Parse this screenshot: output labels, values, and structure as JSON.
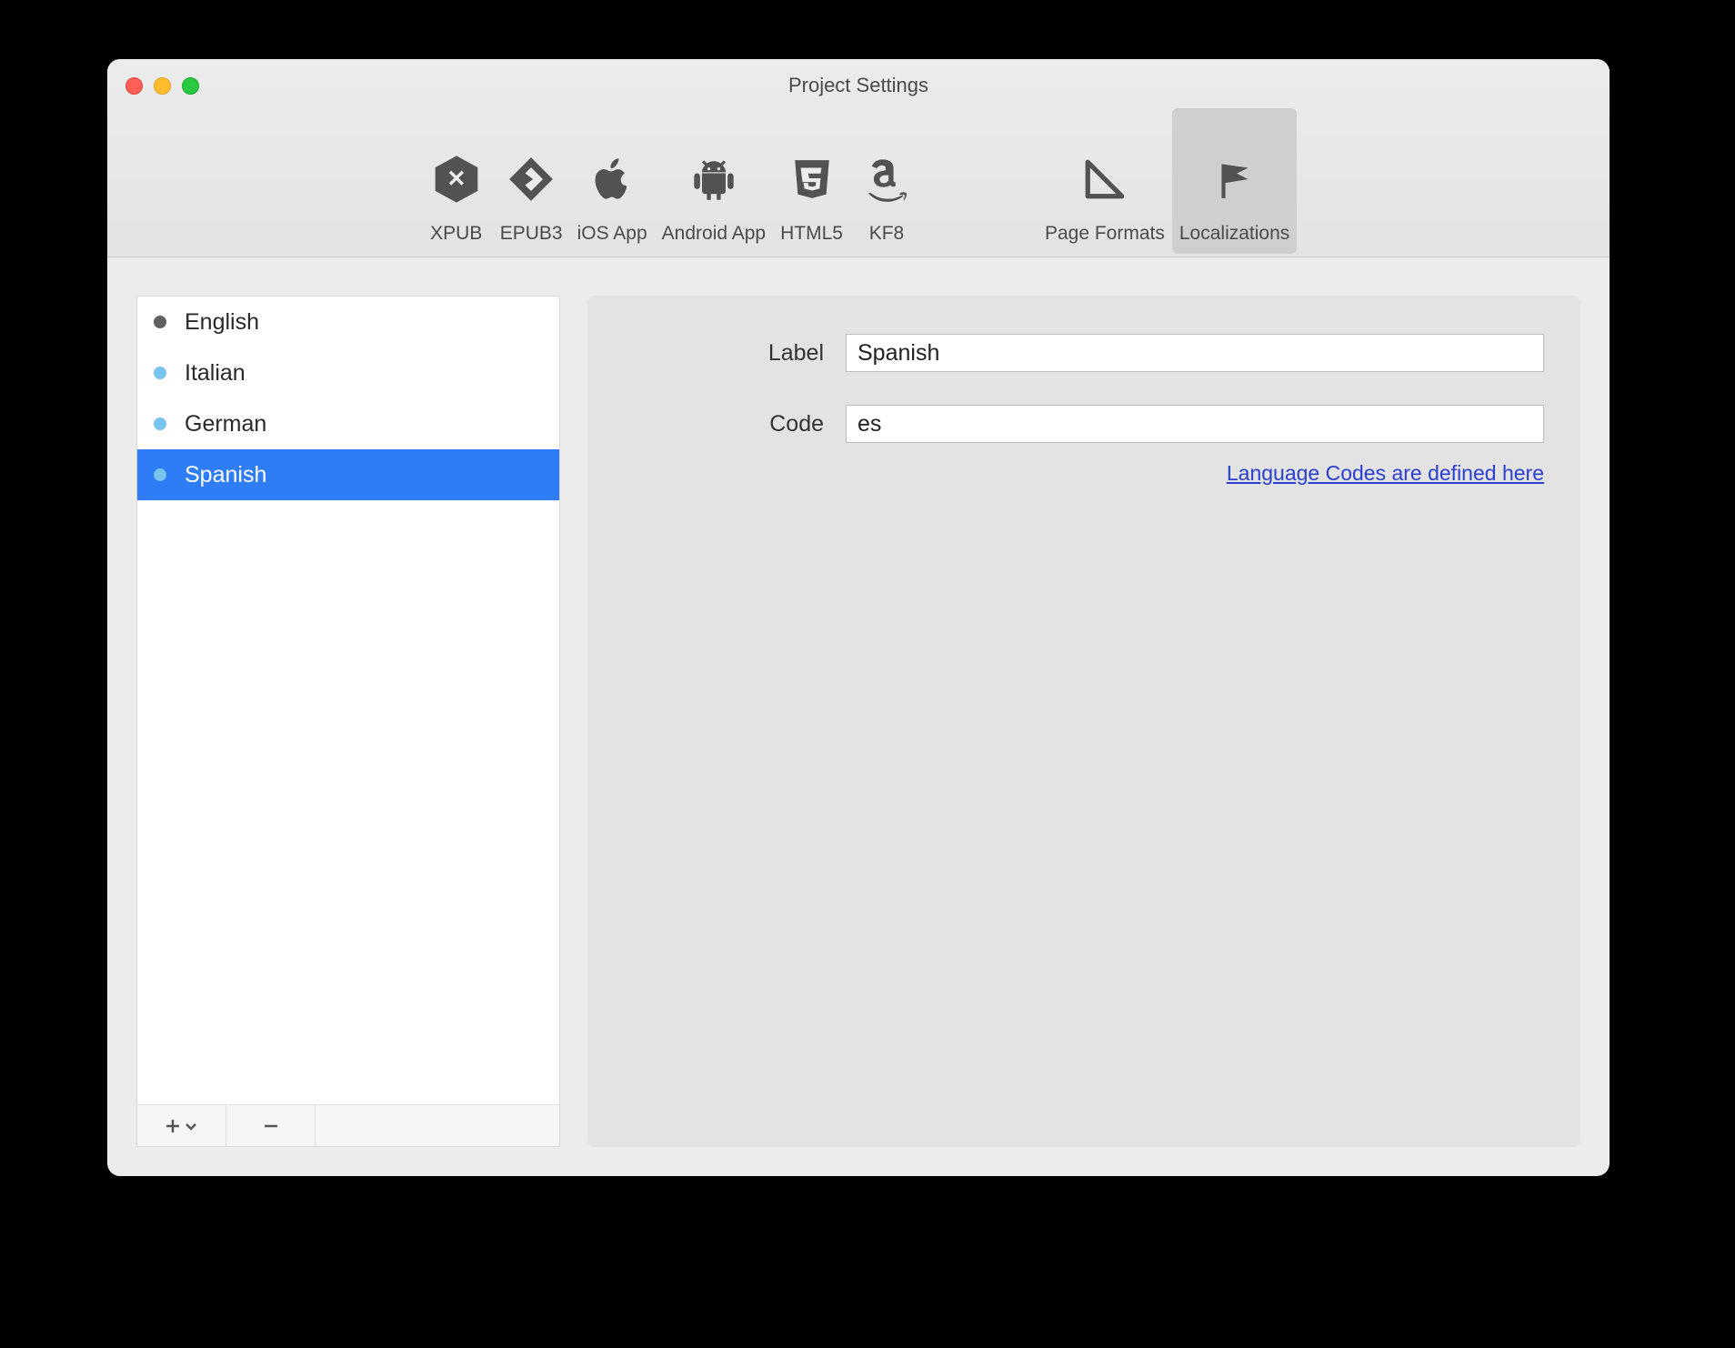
{
  "window": {
    "title": "Project Settings"
  },
  "toolbar": {
    "items": [
      {
        "label": "XPUB"
      },
      {
        "label": "EPUB3"
      },
      {
        "label": "iOS App"
      },
      {
        "label": "Android App"
      },
      {
        "label": "HTML5"
      },
      {
        "label": "KF8"
      }
    ],
    "right_items": [
      {
        "label": "Page Formats"
      },
      {
        "label": "Localizations"
      }
    ],
    "selected": "Localizations"
  },
  "languages": [
    {
      "name": "English",
      "primary": true
    },
    {
      "name": "Italian",
      "primary": false
    },
    {
      "name": "German",
      "primary": false
    },
    {
      "name": "Spanish",
      "primary": false
    }
  ],
  "selected_language_index": 3,
  "form": {
    "label_caption": "Label",
    "label_value": "Spanish",
    "code_caption": "Code",
    "code_value": "es",
    "link_text": "Language Codes are defined here"
  }
}
